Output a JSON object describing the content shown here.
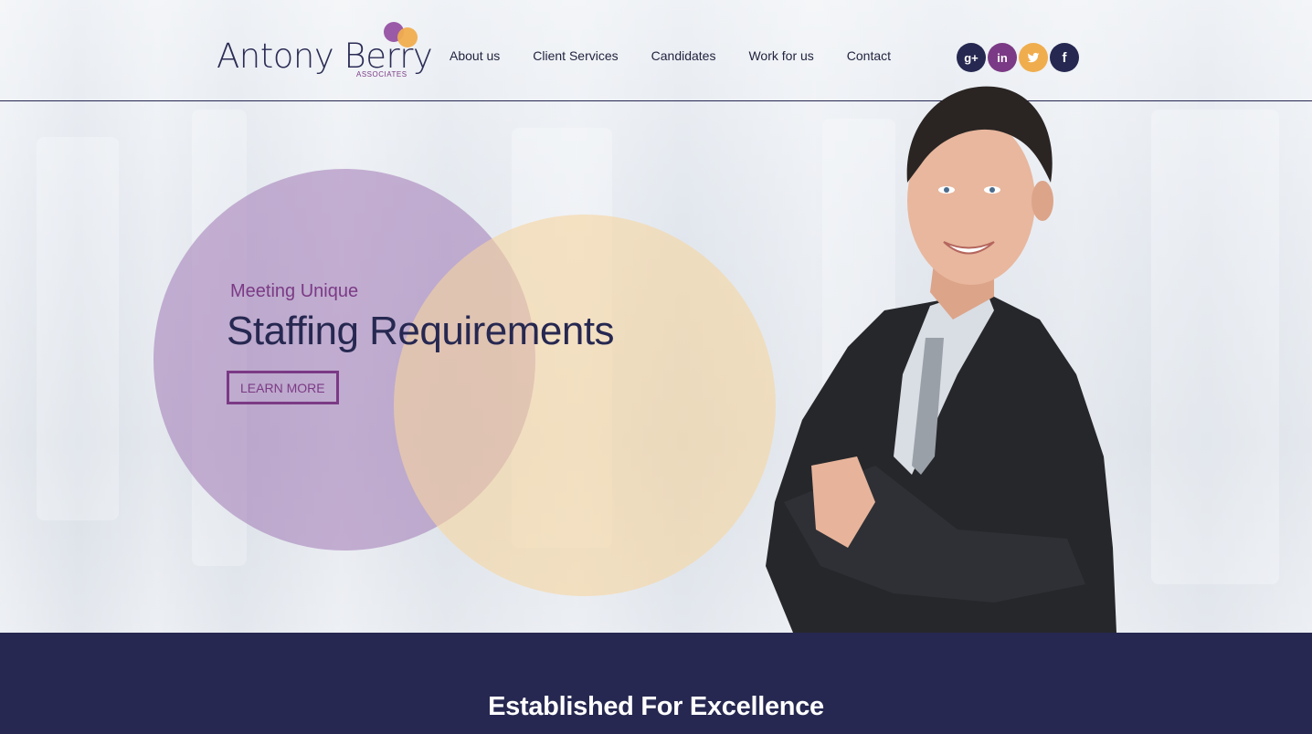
{
  "brand": {
    "name": "Antony Berry",
    "subtitle": "ASSOCIATES",
    "colors": {
      "navy": "#262851",
      "purple": "#7b3a85",
      "orange": "#f0ad4e"
    }
  },
  "nav": {
    "items": [
      "About us",
      "Client Services",
      "Candidates",
      "Work for us",
      "Contact"
    ]
  },
  "social": [
    {
      "name": "google-plus",
      "label": "g+",
      "color": "#262851"
    },
    {
      "name": "linkedin",
      "label": "in",
      "color": "#7b3a85"
    },
    {
      "name": "twitter",
      "label": "twitter",
      "color": "#f0ad4e"
    },
    {
      "name": "facebook",
      "label": "f",
      "color": "#262851"
    }
  ],
  "hero": {
    "subtitle": "Meeting Unique",
    "title": "Staffing Requirements",
    "button": "LEARN MORE"
  },
  "section": {
    "title": "Established For Excellence"
  }
}
